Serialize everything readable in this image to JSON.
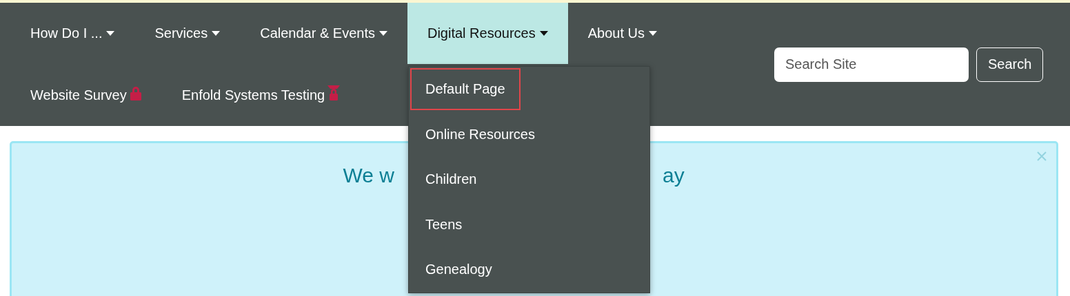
{
  "nav": {
    "items": [
      {
        "label": "How Do I ...",
        "kind": "dropdown",
        "selected": false
      },
      {
        "label": "Services",
        "kind": "dropdown",
        "selected": false
      },
      {
        "label": "Calendar & Events",
        "kind": "dropdown",
        "selected": false
      },
      {
        "label": "Digital Resources",
        "kind": "dropdown",
        "selected": true
      },
      {
        "label": "About Us",
        "kind": "dropdown",
        "selected": false
      },
      {
        "label": "Website Survey",
        "kind": "locked",
        "selected": false
      },
      {
        "label": "Enfold Systems Testing",
        "kind": "capped-lock",
        "selected": false
      }
    ],
    "dropdown": {
      "items": [
        {
          "label": "Default Page",
          "focused": true
        },
        {
          "label": "Online Resources",
          "focused": false
        },
        {
          "label": "Children",
          "focused": false
        },
        {
          "label": "Teens",
          "focused": false
        },
        {
          "label": "Genealogy",
          "focused": false
        }
      ]
    },
    "search": {
      "placeholder": "Search Site",
      "button": "Search"
    }
  },
  "banner": {
    "heading_start": "We w",
    "heading_end": "ay"
  }
}
